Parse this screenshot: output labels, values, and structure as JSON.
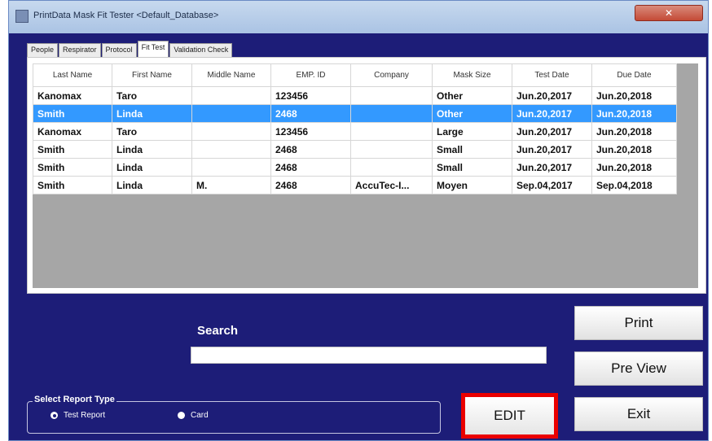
{
  "window": {
    "title": "PrintData Mask Fit Tester <Default_Database>",
    "close_label": "✕"
  },
  "tabs": [
    {
      "label": "People"
    },
    {
      "label": "Respirator"
    },
    {
      "label": "Protocol"
    },
    {
      "label": "Fit Test",
      "active": true
    },
    {
      "label": "Validation Check"
    }
  ],
  "grid": {
    "columns": [
      "Last Name",
      "First Name",
      "Middle Name",
      "EMP. ID",
      "Company",
      "Mask Size",
      "Test Date",
      "Due Date"
    ],
    "rows": [
      [
        "Kanomax",
        "Taro",
        "",
        "123456",
        "",
        "Other",
        "Jun.20,2017",
        "Jun.20,2018"
      ],
      [
        "Smith",
        "Linda",
        "",
        "2468",
        "",
        "Other",
        "Jun.20,2017",
        "Jun.20,2018"
      ],
      [
        "Kanomax",
        "Taro",
        "",
        "123456",
        "",
        "Large",
        "Jun.20,2017",
        "Jun.20,2018"
      ],
      [
        "Smith",
        "Linda",
        "",
        "2468",
        "",
        "Small",
        "Jun.20,2017",
        "Jun.20,2018"
      ],
      [
        "Smith",
        "Linda",
        "",
        "2468",
        "",
        "Small",
        "Jun.20,2017",
        "Jun.20,2018"
      ],
      [
        "Smith",
        "Linda",
        "M.",
        "2468",
        "AccuTec-I...",
        "Moyen",
        "Sep.04,2017",
        "Sep.04,2018"
      ]
    ],
    "selected_row": 1,
    "selection_color": "#3399ff"
  },
  "search": {
    "label": "Search",
    "value": ""
  },
  "buttons": {
    "print": "Print",
    "preview": "Pre View",
    "exit": "Exit",
    "edit": "EDIT"
  },
  "report_type": {
    "legend": "Select Report Type",
    "options": [
      {
        "label": "Test Report",
        "checked": true
      },
      {
        "label": "Card",
        "checked": false
      }
    ]
  },
  "colors": {
    "background": "#1d1d78",
    "highlight_border": "#ea0000"
  }
}
